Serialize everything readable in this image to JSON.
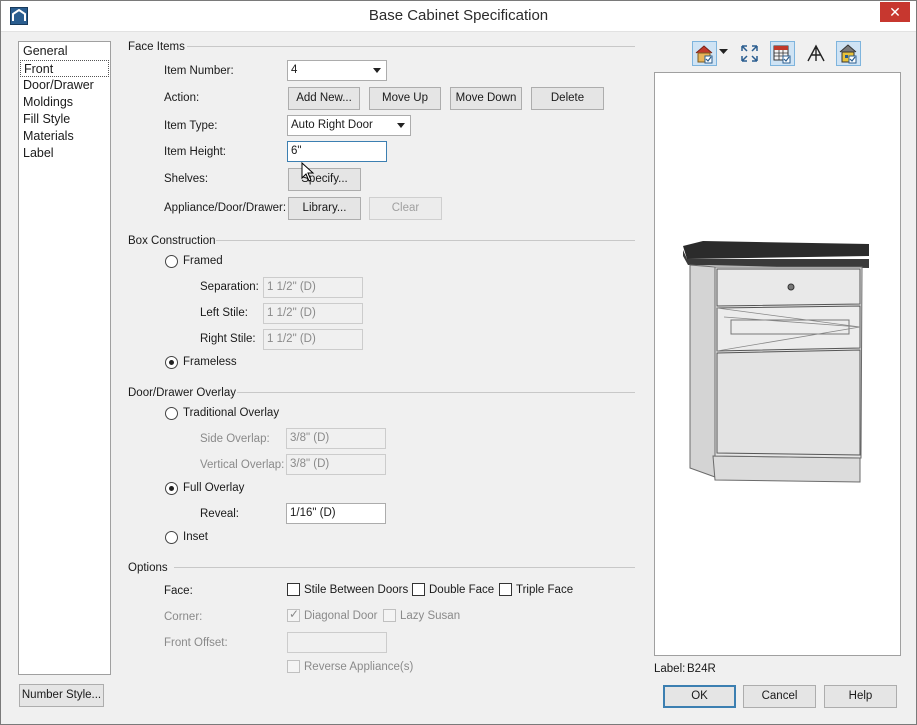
{
  "window": {
    "title": "Base Cabinet Specification",
    "close_glyph": "✕"
  },
  "sidebar": {
    "items": [
      {
        "label": "General",
        "active": false
      },
      {
        "label": "Front",
        "active": true
      },
      {
        "label": "Door/Drawer",
        "active": false
      },
      {
        "label": "Moldings",
        "active": false
      },
      {
        "label": "Fill Style",
        "active": false
      },
      {
        "label": "Materials",
        "active": false
      },
      {
        "label": "Label",
        "active": false
      }
    ]
  },
  "face_items": {
    "section_title": "Face Items",
    "item_number_label": "Item Number:",
    "item_number_value": "4",
    "action_label": "Action:",
    "actions": {
      "add_new": "Add New...",
      "move_up": "Move Up",
      "move_down": "Move Down",
      "delete": "Delete"
    },
    "item_type_label": "Item Type:",
    "item_type_value": "Auto Right Door",
    "item_height_label": "Item Height:",
    "item_height_value": "6\"",
    "shelves_label": "Shelves:",
    "shelves_button": "Specify...",
    "appliance_label": "Appliance/Door/Drawer:",
    "library_button": "Library...",
    "clear_button": "Clear"
  },
  "box_construction": {
    "section_title": "Box Construction",
    "framed_label": "Framed",
    "framed_checked": false,
    "separation_label": "Separation:",
    "separation_value": "1 1/2\" (D)",
    "left_stile_label": "Left Stile:",
    "left_stile_value": "1 1/2\" (D)",
    "right_stile_label": "Right Stile:",
    "right_stile_value": "1 1/2\" (D)",
    "frameless_label": "Frameless",
    "frameless_checked": true
  },
  "overlay": {
    "section_title": "Door/Drawer Overlay",
    "traditional_label": "Traditional Overlay",
    "traditional_checked": false,
    "side_overlap_label": "Side Overlap:",
    "side_overlap_value": "3/8\" (D)",
    "vertical_overlap_label": "Vertical Overlap:",
    "vertical_overlap_value": "3/8\" (D)",
    "full_overlay_label": "Full Overlay",
    "full_overlay_checked": true,
    "reveal_label": "Reveal:",
    "reveal_value": "1/16\" (D)",
    "inset_label": "Inset",
    "inset_checked": false
  },
  "options": {
    "section_title": "Options",
    "face_label": "Face:",
    "stile_between_doors": "Stile Between Doors",
    "double_face": "Double Face",
    "triple_face": "Triple Face",
    "corner_label": "Corner:",
    "diagonal_door": "Diagonal Door",
    "diagonal_door_checked": true,
    "lazy_susan": "Lazy Susan",
    "front_offset_label": "Front Offset:",
    "front_offset_value": "",
    "reverse_appliance": "Reverse Appliance(s)"
  },
  "preview": {
    "toolbar_icons": [
      "camera-view-icon",
      "fill-window-icon",
      "color-toggle-icon",
      "line-drawing-icon",
      "material-view-icon"
    ],
    "label_caption": "Label:",
    "label_value": "B24R",
    "colors": {
      "countertop": "#2b2b2b",
      "cabinet": "#e6e6e6",
      "edge": "#6b6b6b"
    }
  },
  "footer": {
    "number_style_button": "Number Style...",
    "ok_button": "OK",
    "cancel_button": "Cancel",
    "help_button": "Help"
  }
}
